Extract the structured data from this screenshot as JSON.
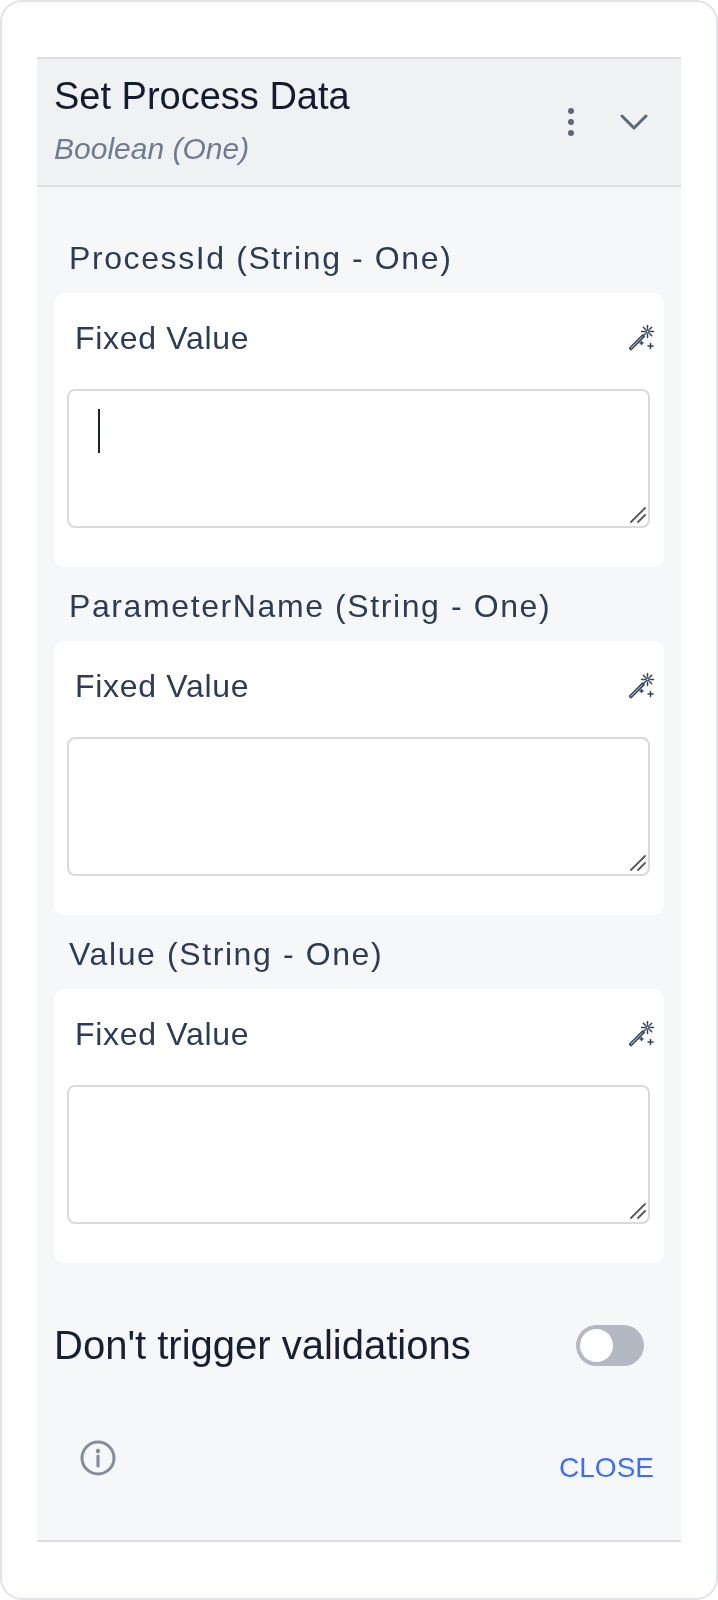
{
  "panel": {
    "title": "Set Process Data",
    "subtitle": "Boolean (One)"
  },
  "parameters": [
    {
      "label": "ProcessId (String - One)",
      "mode": "Fixed Value",
      "focused": true
    },
    {
      "label": "ParameterName (String - One)",
      "mode": "Fixed Value",
      "focused": false
    },
    {
      "label": "Value (String - One)",
      "mode": "Fixed Value",
      "focused": false
    }
  ],
  "validation": {
    "label": "Don't trigger validations",
    "on": false
  },
  "footer": {
    "close": "CLOSE"
  }
}
